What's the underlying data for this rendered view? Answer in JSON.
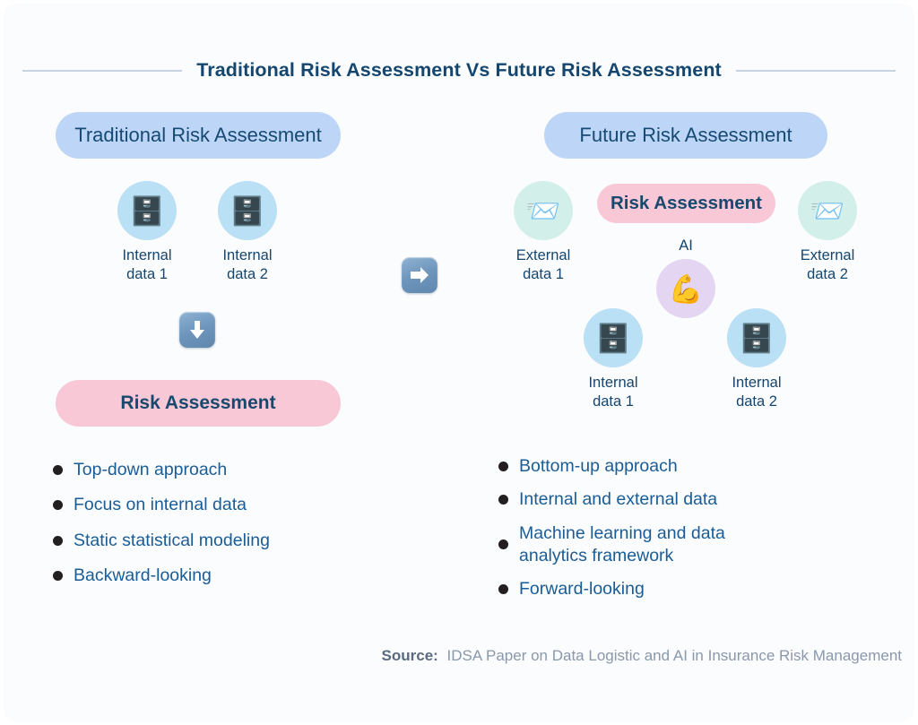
{
  "header": {
    "title": "Traditional Risk Assessment Vs Future Risk Assessment"
  },
  "colors": {
    "title": "#14466f",
    "pill_head_bg": "#bdd6f7",
    "pill_risk_bg": "#f9c8d6",
    "circle_blue": "#b9e0f4",
    "circle_mint": "#d3efea",
    "circle_lavender": "#e4d6f2",
    "bullet_text": "#1a5c96",
    "bullet_dot": "#231f20",
    "source_text": "#8a98ab",
    "rule": "#c9d2e0",
    "card_bg": "#fbfcfd"
  },
  "left_panel": {
    "heading": "Traditional Risk Assessment",
    "nodes": [
      {
        "label": "Internal\ndata 1",
        "icon": "file-cabinet-icon",
        "glyph": "🗄️",
        "circle": "blue"
      },
      {
        "label": "Internal\ndata 2",
        "icon": "file-cabinet-icon",
        "glyph": "🗄️",
        "circle": "blue"
      }
    ],
    "flow_arrow": "down-arrow-icon",
    "result_pill": "Risk Assessment",
    "bullets": [
      "Top-down approach",
      "Focus on internal data",
      "Static statistical modeling",
      "Backward-looking"
    ]
  },
  "center": {
    "transition_arrow": "right-arrow-icon"
  },
  "right_panel": {
    "heading": "Future Risk Assessment",
    "result_pill": "Risk Assessment",
    "ai_label": "AI",
    "nodes": [
      {
        "label": "External\ndata 1",
        "icon": "inbox-envelope-icon",
        "glyph": "📨",
        "circle": "mint"
      },
      {
        "label": "External\ndata 2",
        "icon": "inbox-envelope-icon",
        "glyph": "📨",
        "circle": "mint"
      },
      {
        "label": "AI",
        "icon": "flexed-biceps-icon",
        "glyph": "💪",
        "circle": "lavender"
      },
      {
        "label": "Internal\ndata 1",
        "icon": "file-cabinet-icon",
        "glyph": "🗄️",
        "circle": "blue"
      },
      {
        "label": "Internal\ndata 2",
        "icon": "file-cabinet-icon",
        "glyph": "🗄️",
        "circle": "blue"
      }
    ],
    "bullets": [
      "Bottom-up approach",
      "Internal and external data",
      "Machine learning and data\nanalytics framework",
      "Forward-looking"
    ]
  },
  "footer": {
    "source_label": "Source:",
    "source_text": "IDSA Paper on Data Logistic and AI in Insurance Risk Management"
  }
}
